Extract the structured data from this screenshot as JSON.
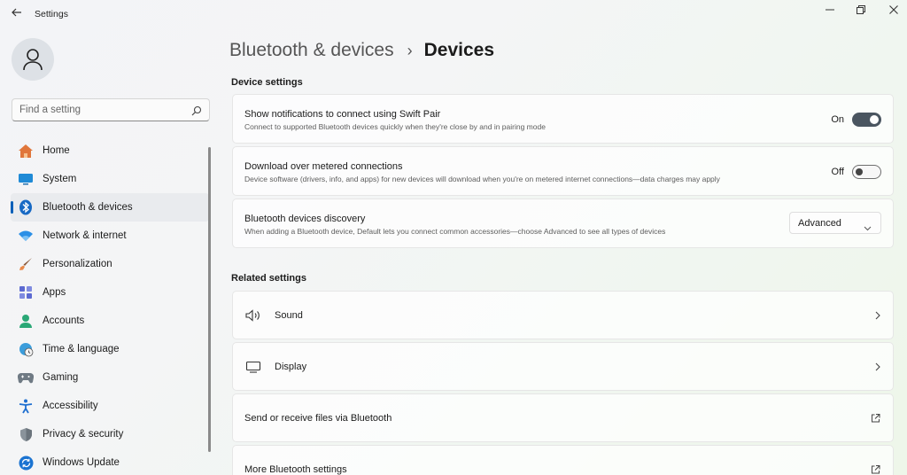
{
  "window": {
    "title": "Settings",
    "back_icon": "arrow-left-icon",
    "minimize_icon": "minimize-icon",
    "restore_icon": "restore-icon",
    "close_icon": "close-icon"
  },
  "user": {
    "avatar_icon": "person-icon"
  },
  "search": {
    "placeholder": "Find a setting",
    "icon": "search-icon"
  },
  "nav": {
    "accent": "#005fb8",
    "items": [
      {
        "label": "Home",
        "icon": "home-icon"
      },
      {
        "label": "System",
        "icon": "system-icon"
      },
      {
        "label": "Bluetooth & devices",
        "icon": "bluetooth-icon",
        "active": true
      },
      {
        "label": "Network & internet",
        "icon": "wifi-icon"
      },
      {
        "label": "Personalization",
        "icon": "brush-icon"
      },
      {
        "label": "Apps",
        "icon": "apps-icon"
      },
      {
        "label": "Accounts",
        "icon": "accounts-icon"
      },
      {
        "label": "Time & language",
        "icon": "globe-clock-icon"
      },
      {
        "label": "Gaming",
        "icon": "gamepad-icon"
      },
      {
        "label": "Accessibility",
        "icon": "accessibility-icon"
      },
      {
        "label": "Privacy & security",
        "icon": "shield-icon"
      },
      {
        "label": "Windows Update",
        "icon": "update-icon"
      }
    ]
  },
  "breadcrumb": {
    "parent": "Bluetooth & devices",
    "separator": "›",
    "current": "Devices"
  },
  "device_settings": {
    "title": "Device settings",
    "swift_pair": {
      "title": "Show notifications to connect using Swift Pair",
      "description": "Connect to supported Bluetooth devices quickly when they're close by and in pairing mode",
      "state_label": "On",
      "enabled": true
    },
    "metered": {
      "title": "Download over metered connections",
      "description": "Device software (drivers, info, and apps) for new devices will download when you're on metered internet connections—data charges may apply",
      "state_label": "Off",
      "enabled": false
    },
    "discovery": {
      "title": "Bluetooth devices discovery",
      "description": "When adding a Bluetooth device, Default lets you connect common accessories—choose Advanced to see all types of devices",
      "selected": "Advanced"
    }
  },
  "related_settings": {
    "title": "Related settings",
    "items": [
      {
        "label": "Sound",
        "icon": "speaker-icon",
        "action": "chevron-right-icon"
      },
      {
        "label": "Display",
        "icon": "monitor-icon",
        "action": "chevron-right-icon"
      },
      {
        "label": "Send or receive files via Bluetooth",
        "action": "open-external-icon"
      },
      {
        "label": "More Bluetooth settings",
        "action": "open-external-icon"
      }
    ]
  }
}
